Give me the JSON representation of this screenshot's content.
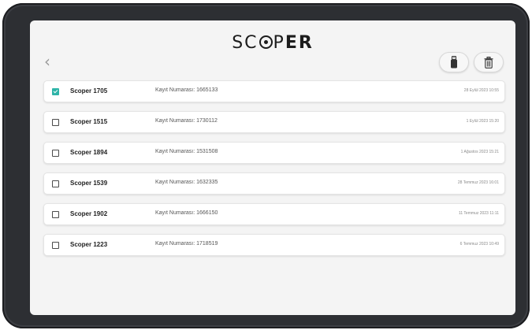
{
  "app": {
    "logo_light": "SC",
    "logo_light2": "P",
    "logo_bold": "ER",
    "back_icon": "chevron-left-icon",
    "actions": [
      {
        "name": "usb-icon"
      },
      {
        "name": "trash-icon"
      }
    ]
  },
  "records": [
    {
      "name": "Scoper 1705",
      "record": "Kayıt Numarası: 1665133",
      "date": "28 Eylül 2023 10:55",
      "checked": true
    },
    {
      "name": "Scoper 1515",
      "record": "Kayıt Numarası: 1730112",
      "date": "1 Eylül 2023 15:20",
      "checked": false
    },
    {
      "name": "Scoper 1894",
      "record": "Kayıt Numarası: 1531508",
      "date": "1 Ağustos 2023 15:21",
      "checked": false
    },
    {
      "name": "Scoper 1539",
      "record": "Kayıt Numarası: 1632335",
      "date": "28 Temmuz 2023 16:01",
      "checked": false
    },
    {
      "name": "Scoper 1902",
      "record": "Kayıt Numarası: 1666150",
      "date": "11 Temmuz 2023 11:11",
      "checked": false
    },
    {
      "name": "Scoper 1223",
      "record": "Kayıt Numarası: 1718519",
      "date": "6 Temmuz 2023 10:49",
      "checked": false
    }
  ],
  "colors": {
    "checkbox_checked": "#2eb4a8",
    "device_frame": "#2d2f33",
    "screen_bg": "#f4f4f4"
  }
}
